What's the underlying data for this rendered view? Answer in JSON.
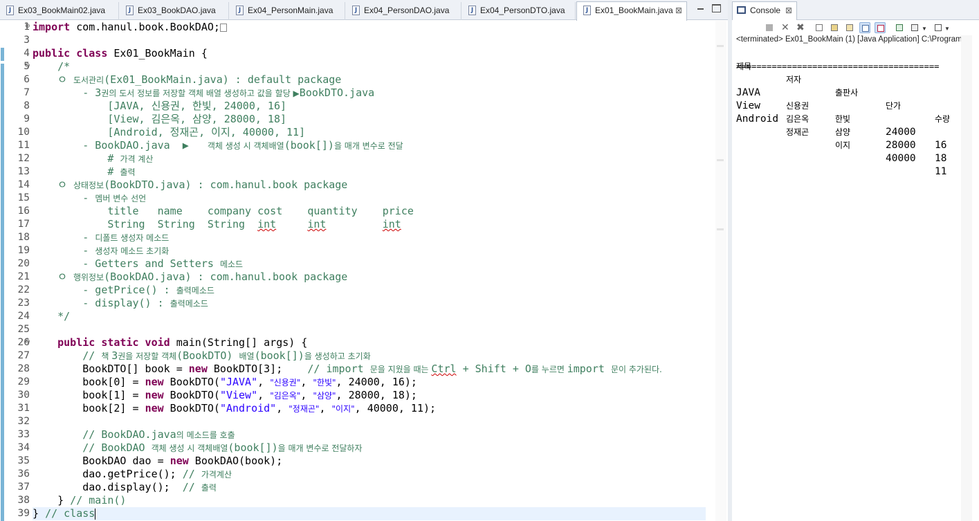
{
  "editor": {
    "tabs": [
      {
        "label": "Ex03_BookMain02.java",
        "active": false
      },
      {
        "label": "Ex03_BookDAO.java",
        "active": false
      },
      {
        "label": "Ex04_PersonMain.java",
        "active": false
      },
      {
        "label": "Ex04_PersonDAO.java",
        "active": false
      },
      {
        "label": "Ex04_PersonDTO.java",
        "active": false
      },
      {
        "label": "Ex01_BookMain.java",
        "active": true
      }
    ],
    "file_icon_glyph": "J",
    "close_glyph": "⊠",
    "line_numbers": [
      "1",
      "3",
      "4",
      "5",
      "6",
      "7",
      "8",
      "9",
      "10",
      "11",
      "12",
      "13",
      "14",
      "15",
      "16",
      "17",
      "18",
      "19",
      "20",
      "21",
      "22",
      "23",
      "24",
      "25",
      "26",
      "27",
      "28",
      "29",
      "30",
      "31",
      "32",
      "33",
      "34",
      "35",
      "36",
      "37",
      "38",
      "39"
    ],
    "code": {
      "l1_kw": "import",
      "l1": " com.hanul.book.BookDAO;",
      "l4_kw1": "public class",
      "l4": " Ex01_BookMain {",
      "l5": "    /*",
      "l6a": "    ㅇ ",
      "l6b": "도서관리",
      "l6c": "(Ex01_BookMain.java) : default package",
      "l7a": "        - 3",
      "l7b": "권의 도서 정보를 저장할 객체 배열 생성하고 값을 할당 ▶",
      "l7c": "BookDTO.java",
      "l8": "            [JAVA, 신용권, 한빛, 24000, 16]",
      "l9": "            [View, 김은옥, 삼양, 28000, 18]",
      "l10": "            [Android, 정재곤, 이지, 40000, 11]",
      "l11a": "        - BookDAO.java  ▶   ",
      "l11b": "객체 생성 시 객체배열",
      "l11c": "(book[])",
      "l11d": "을 매개 변수로 전달",
      "l12a": "            # ",
      "l12b": "가격 계산",
      "l13a": "            # ",
      "l13b": "출력",
      "l14a": "    ㅇ ",
      "l14b": "상태정보",
      "l14c": "(BookDTO.java) : com.hanul.book package",
      "l15a": "        - ",
      "l15b": "멤버 변수 선언",
      "l16": "            title   name    company cost    quantity    price",
      "l17a": "            String  String  String  ",
      "l17b": "int",
      "l17c": "     ",
      "l17d": "int",
      "l17e": "         ",
      "l17f": "int",
      "l18a": "        - ",
      "l18b": "디폴트 생성자 메소드",
      "l19a": "        - ",
      "l19b": "생성자 메소드 초기화",
      "l20a": "        - Getters and Setters ",
      "l20b": "메소드",
      "l21a": "    ㅇ ",
      "l21b": "행위정보",
      "l21c": "(BookDAO.java) : com.hanul.book package",
      "l22a": "        - getPrice() : ",
      "l22b": "출력메소드",
      "l23a": "        - display() : ",
      "l23b": "출력메소드",
      "l24": "    */",
      "l26_kw": "public static void",
      "l26": " main(String[] args) {",
      "l27a": "        // ",
      "l27b": "책 ",
      "l27c": "3",
      "l27d": "권을 저장할 객체",
      "l27e": "(BookDTO) ",
      "l27f": "배열",
      "l27g": "(book[])",
      "l27h": "을 생성하고 초기화",
      "l28a": "        BookDTO[] book = ",
      "l28_kw": "new",
      "l28b": " BookDTO[3];    ",
      "l28c": "// import ",
      "l28d": "문을 지웠을 때는 ",
      "l28e": "Ctrl",
      "l28f": " + Shift + O",
      "l28g": "를 누르면 ",
      "l28h": "import ",
      "l28i": "문이 추가된다.",
      "l29a": "        book[0] = ",
      "l29b": " BookDTO(",
      "l29s1": "\"JAVA\"",
      "l29s2": "\"신용권\"",
      "l29s3": "\"한빛\"",
      "l29c": ", 24000, 16);",
      "l30a": "        book[1] = ",
      "l30s1": "\"View\"",
      "l30s2": "\"김은옥\"",
      "l30s3": "\"삼양\"",
      "l30c": ", 28000, 18);",
      "l31a": "        book[2] = ",
      "l31s1": "\"Android\"",
      "l31s2": "\"정재곤\"",
      "l31s3": "\"이지\"",
      "l31c": ", 40000, 11);",
      "comma": ", ",
      "l33a": "        // BookDAO.java",
      "l33b": "의 메소드를 호출",
      "l34a": "        // BookDAO ",
      "l34b": "객체 생성 시 객체배열",
      "l34c": "(book[])",
      "l34d": "을 매개 변수로 전달하자",
      "l35a": "        BookDAO dao = ",
      "l35b": " BookDAO(book);",
      "l36a": "        dao.getPrice(); ",
      "l36b": "// ",
      "l36c": "가격계산",
      "l37a": "        dao.display();  ",
      "l37b": "// ",
      "l37c": "출력",
      "l38a": "    } ",
      "l38b": "// main()",
      "l39a": "} ",
      "l39b": "// class"
    }
  },
  "console": {
    "tab_label": "Console",
    "status": "<terminated> Ex01_BookMain (1) [Java Application] C:\\Program",
    "headers": [
      "제목",
      "저자",
      "출판사",
      "단가",
      "수량"
    ],
    "separator": "========================================",
    "rows": [
      [
        "JAVA",
        "신용권",
        "한빛",
        "24000",
        "16"
      ],
      [
        "View",
        "김은옥",
        "삼양",
        "28000",
        "18"
      ],
      [
        "Android",
        "정재곤",
        "이지",
        "40000",
        "11"
      ]
    ]
  }
}
